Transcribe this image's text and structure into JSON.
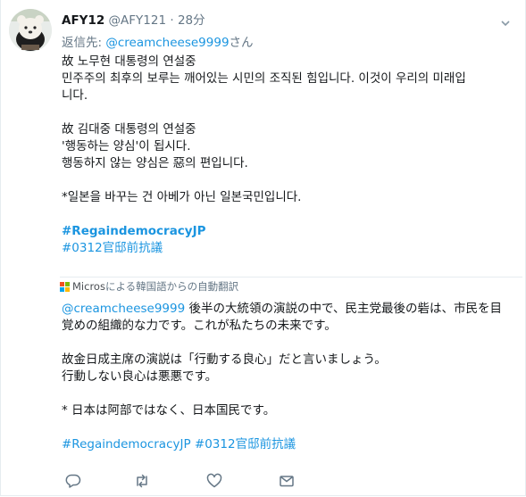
{
  "user": {
    "display_name": "AFY12",
    "handle": "@AFY121",
    "separator": "·",
    "time": "28分"
  },
  "reply_to": {
    "prefix": "返信先: ",
    "handle": "@creamcheese9999",
    "suffix": "さん"
  },
  "tweet": {
    "lines": [
      "故 노무현 대통령의 연설중",
      "민주주의 최후의 보루는 깨어있는 시민의 조직된 힘입니다. 이것이 우리의 미래입",
      "니다.",
      "",
      "故 김대중 대통령의 연설중",
      "'행동하는 양심'이 됩시다.",
      "행동하지 않는 양심은 惡의 편입니다.",
      "",
      "*일본을 바꾸는 건 아베가 아닌 일본국민입니다.",
      ""
    ],
    "hashtag_primary": "#RegaindemocracyJP",
    "hashtag_secondary": "#0312官邸前抗議"
  },
  "translation_bar": {
    "provider": "Micros",
    "text": "による韓国語からの自動翻訳"
  },
  "translation": {
    "mention": "@creamcheese9999",
    "line1_rest": " 後半の大統領の演説の中で、民主党最後の砦は、市民を目",
    "lines": [
      "覚めの組織的な力です。これが私たちの未来です。",
      "",
      "故金日成主席の演説は「行動する良心」だと言いましょう。",
      "行動しない良心は悪悪です。",
      "",
      "* 日本は阿部ではなく、日本国民です。",
      ""
    ],
    "hashtags": "#RegaindemocracyJP #0312官邸前抗議"
  },
  "icons": {
    "reply": "reply-icon",
    "retweet": "retweet-icon",
    "like": "heart-icon",
    "dm": "envelope-icon",
    "menu": "chevron-down-icon"
  },
  "colors": {
    "link": "#1b95e0",
    "muted": "#657786",
    "text": "#14171a"
  }
}
